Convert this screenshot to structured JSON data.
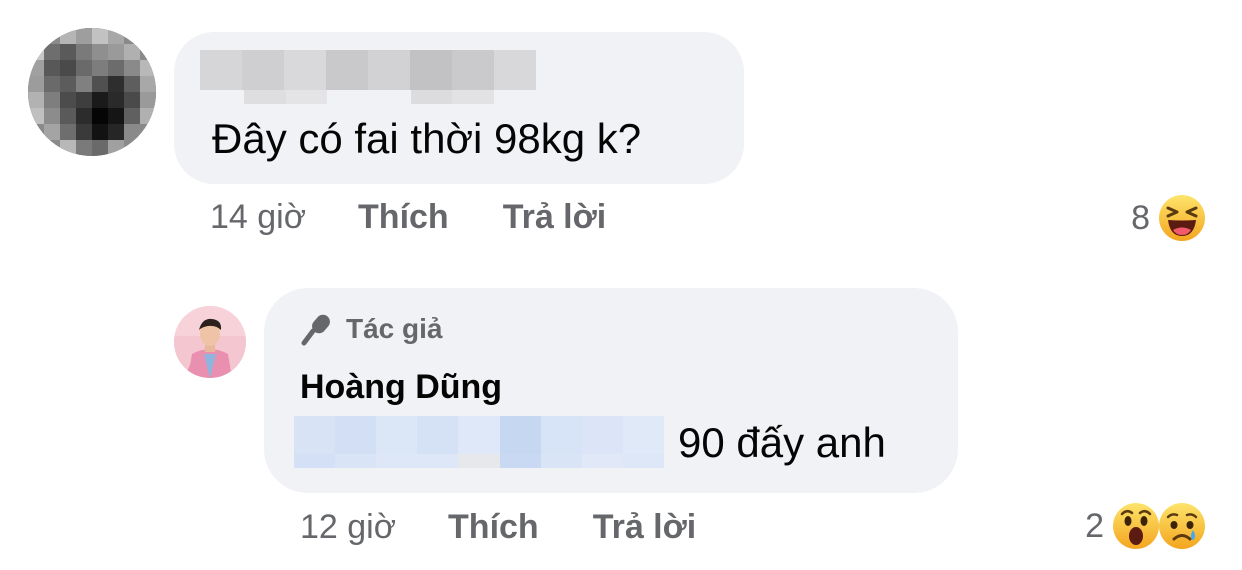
{
  "comments": [
    {
      "author_hidden": true,
      "text": "Đây có fai thời 98kg k?",
      "time": "14 giờ",
      "like_label": "Thích",
      "reply_label": "Trả lời",
      "reaction_count": "8",
      "reactions": [
        "haha-icon"
      ]
    },
    {
      "badge_label": "Tác giả",
      "badge_icon": "microphone-icon",
      "author": "Hoàng Dũng",
      "mention_hidden": true,
      "text": "90 đấy anh",
      "time": "12 giờ",
      "like_label": "Thích",
      "reply_label": "Trả lời",
      "reaction_count": "2",
      "reactions": [
        "wow-icon",
        "sad-icon"
      ]
    }
  ],
  "colors": {
    "bubble": "#f0f2f5",
    "secondary_text": "#65676b",
    "primary_text": "#050505",
    "reaction_yellow": "#f7b125"
  }
}
